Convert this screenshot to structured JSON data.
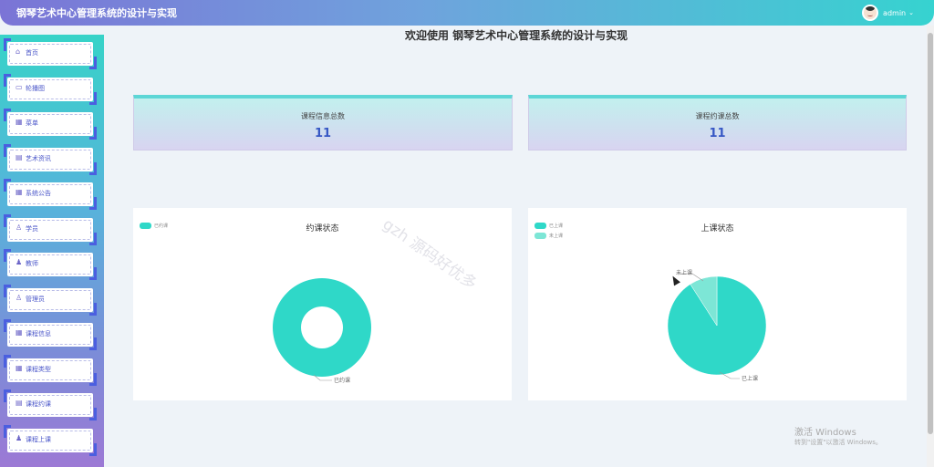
{
  "header": {
    "title": "钢琴艺术中心管理系统的设计与实现",
    "username": "admin"
  },
  "sidebar": {
    "items": [
      {
        "label": "首页",
        "icon": "home-icon"
      },
      {
        "label": "轮播图",
        "icon": "image-icon"
      },
      {
        "label": "菜单",
        "icon": "grid-icon"
      },
      {
        "label": "艺术资讯",
        "icon": "document-icon"
      },
      {
        "label": "系统公告",
        "icon": "grid-icon"
      },
      {
        "label": "学员",
        "icon": "user-icon"
      },
      {
        "label": "教师",
        "icon": "teacher-icon"
      },
      {
        "label": "管理员",
        "icon": "user-icon"
      },
      {
        "label": "课程信息",
        "icon": "grid-icon"
      },
      {
        "label": "课程类型",
        "icon": "grid-icon"
      },
      {
        "label": "课程约课",
        "icon": "calendar-icon"
      },
      {
        "label": "课程上课",
        "icon": "teacher-icon"
      }
    ]
  },
  "main": {
    "welcome": "欢迎使用 钢琴艺术中心管理系统的设计与实现",
    "stats": [
      {
        "label": "课程信息总数",
        "value": "11"
      },
      {
        "label": "课程约课总数",
        "value": "11"
      }
    ]
  },
  "charts": {
    "colors": {
      "primary": "#2fd8c8",
      "secondary": "#7de6d6"
    }
  },
  "chart_data": [
    {
      "type": "pie",
      "title": "约课状态",
      "legend": [
        "已约课"
      ],
      "slices": [
        {
          "label": "已约课",
          "value": 1
        }
      ],
      "donut": true
    },
    {
      "type": "pie",
      "title": "上课状态",
      "legend": [
        "已上课",
        "未上课"
      ],
      "slices": [
        {
          "label": "已上课",
          "value": 10
        },
        {
          "label": "未上课",
          "value": 1
        }
      ]
    }
  ],
  "overlay": {
    "watermark": "gzh 源码好优多",
    "activate_title": "激活 Windows",
    "activate_sub": "转到\"设置\"以激活 Windows。"
  }
}
